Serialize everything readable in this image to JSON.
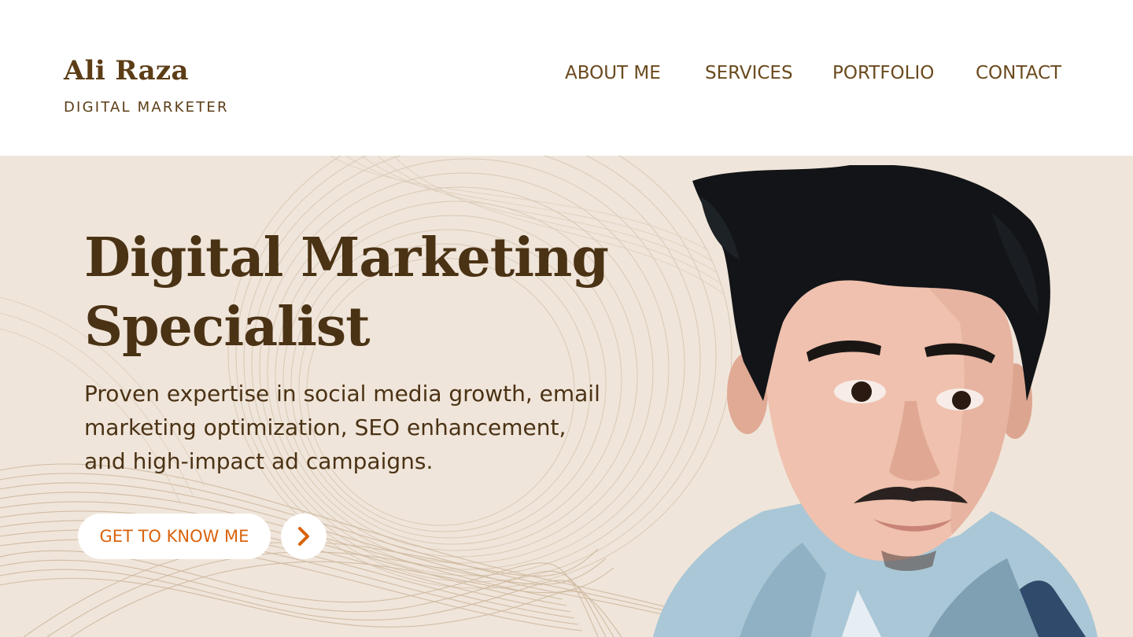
{
  "header": {
    "brand_name": "Ali Raza",
    "brand_tagline": "DIGITAL MARKETER",
    "nav": [
      {
        "label": "ABOUT ME"
      },
      {
        "label": "SERVICES"
      },
      {
        "label": "PORTFOLIO"
      },
      {
        "label": "CONTACT"
      }
    ]
  },
  "hero": {
    "title_line1": "Digital Marketing",
    "title_line2": "Specialist",
    "subtitle_line1": "Proven expertise in social media growth, email",
    "subtitle_line2": "marketing optimization, SEO enhancement,",
    "subtitle_line3": "and high-impact ad campaigns.",
    "cta_label": "GET TO KNOW ME",
    "cta_icon": "chevron-right-icon",
    "portrait_image": "portrait-photo"
  },
  "colors": {
    "brand_brown": "#5c3d16",
    "dark_brown": "#4a3214",
    "hero_background": "#f0e5da",
    "accent_orange": "#d9630b",
    "wave_lines": "#d8c8b4"
  }
}
